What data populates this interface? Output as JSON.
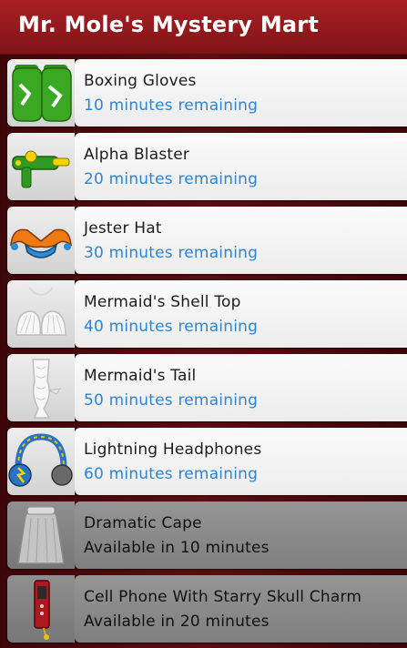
{
  "header": {
    "title": "Mr. Mole's Mystery Mart"
  },
  "items": [
    {
      "name": "Boxing Gloves",
      "status": "10 minutes remaining",
      "icon": "boxing-gloves-icon",
      "available": true
    },
    {
      "name": "Alpha Blaster",
      "status": "20 minutes remaining",
      "icon": "blaster-icon",
      "available": true
    },
    {
      "name": "Jester Hat",
      "status": "30 minutes remaining",
      "icon": "jester-hat-icon",
      "available": true
    },
    {
      "name": "Mermaid's Shell Top",
      "status": "40 minutes remaining",
      "icon": "shell-top-icon",
      "available": true
    },
    {
      "name": "Mermaid's Tail",
      "status": "50 minutes remaining",
      "icon": "mermaid-tail-icon",
      "available": true
    },
    {
      "name": "Lightning Headphones",
      "status": "60 minutes remaining",
      "icon": "headphones-icon",
      "available": true
    },
    {
      "name": "Dramatic Cape",
      "status": "Available in 10 minutes",
      "icon": "cape-icon",
      "available": false
    },
    {
      "name": "Cell Phone With Starry Skull Charm",
      "status": "Available in 20 minutes",
      "icon": "cell-phone-icon",
      "available": false
    }
  ],
  "colors": {
    "header": "#951a1e",
    "status_active": "#2b86d9",
    "status_locked": "#111111"
  }
}
